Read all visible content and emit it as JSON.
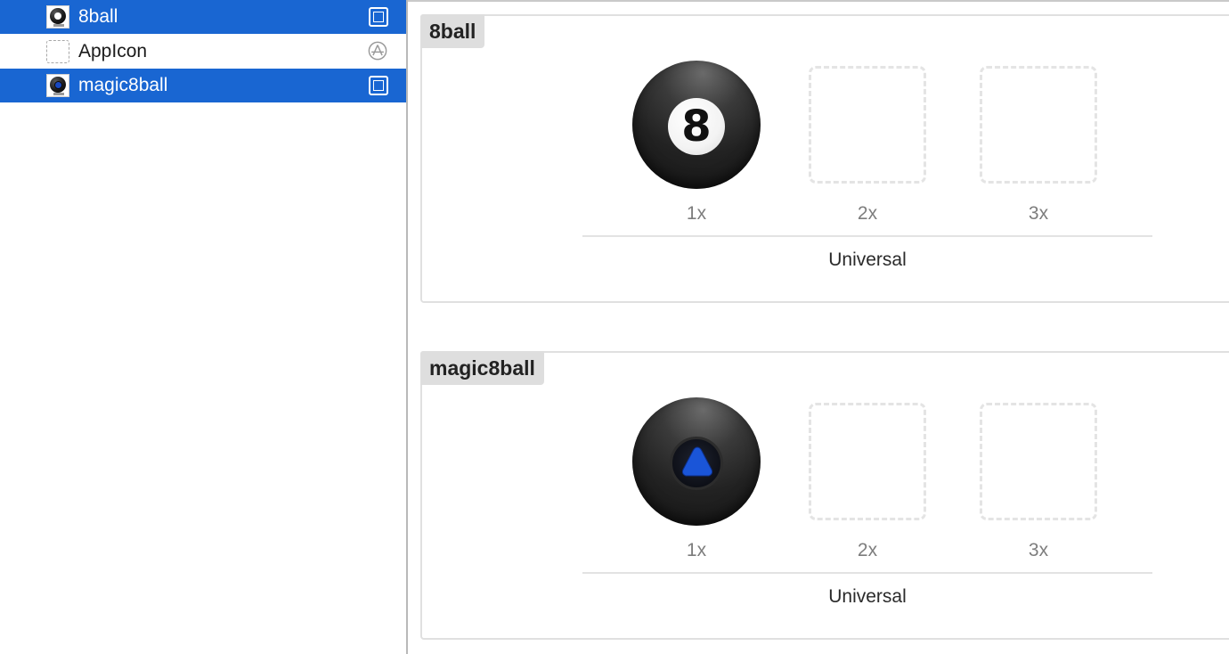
{
  "sidebar": {
    "items": [
      {
        "label": "8ball",
        "selected": true,
        "icon": "eight-ball-thumbnail",
        "badge": "image-set-badge-icon"
      },
      {
        "label": "AppIcon",
        "selected": false,
        "icon": "empty-placeholder-thumbnail",
        "badge": "app-store-icon"
      },
      {
        "label": "magic8ball",
        "selected": true,
        "icon": "magic-eight-ball-thumbnail",
        "badge": "image-set-badge-icon"
      }
    ],
    "selection_color": "#1966d2"
  },
  "main": {
    "image_sets": [
      {
        "name": "8ball",
        "slots": [
          {
            "scale": "1x",
            "filled": true,
            "ball_number": "8"
          },
          {
            "scale": "2x",
            "filled": false
          },
          {
            "scale": "3x",
            "filled": false
          }
        ],
        "device": "Universal"
      },
      {
        "name": "magic8ball",
        "slots": [
          {
            "scale": "1x",
            "filled": true
          },
          {
            "scale": "2x",
            "filled": false
          },
          {
            "scale": "3x",
            "filled": false
          }
        ],
        "device": "Universal"
      }
    ]
  },
  "colors": {
    "eight_ball_window_triangle": "#1a55d8"
  }
}
